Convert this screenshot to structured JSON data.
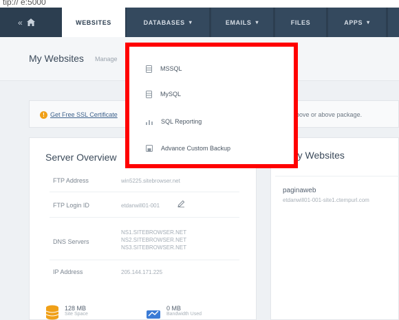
{
  "window": {
    "top_strip_text": "tip:// e:5000"
  },
  "navbar": {
    "home_label": "«",
    "tabs": [
      {
        "label": "WEBSITES",
        "active": true,
        "has_caret": false
      },
      {
        "label": "DATABASES",
        "active": false,
        "has_caret": true
      },
      {
        "label": "EMAILS",
        "active": false,
        "has_caret": true
      },
      {
        "label": "FILES",
        "active": false,
        "has_caret": false
      },
      {
        "label": "APPS",
        "active": false,
        "has_caret": true
      }
    ],
    "caret": "▾"
  },
  "header": {
    "title": "My Websites",
    "subtitle": "Manage"
  },
  "notice": {
    "icon": "!",
    "link_text": "Get Free SSL Certificate",
    "text": "above or above package."
  },
  "server_overview": {
    "title": "Server Overview",
    "rows": [
      {
        "label": "FTP Address",
        "values": [
          "win5225.sitebrowser.net"
        ]
      },
      {
        "label": "FTP Login ID",
        "values": [
          "etdanwill01-001"
        ]
      },
      {
        "label": "DNS Servers",
        "values": [
          "NS1.SITEBROWSER.NET",
          "NS2.SITEBROWSER.NET",
          "NS3.SITEBROWSER.NET"
        ]
      },
      {
        "label": "IP Address",
        "values": [
          "205.144.171.225"
        ]
      }
    ],
    "stats": [
      {
        "value": "128 MB",
        "label": "Site Space"
      },
      {
        "value": "0 MB",
        "label": "Bandwidth Used"
      }
    ]
  },
  "my_websites": {
    "title": "My Websites",
    "site_name": "paginaweb",
    "site_sub": "etdanwill01-001-site1.ctempurl.com"
  },
  "databases_menu": {
    "items": [
      {
        "label": "MSSQL",
        "icon": "database-icon"
      },
      {
        "label": "MySQL",
        "icon": "database-icon"
      },
      {
        "label": "SQL Reporting",
        "icon": "bar-chart-icon"
      },
      {
        "label": "Advance Custom Backup",
        "icon": "backup-icon"
      }
    ],
    "highlight_color": "#ff0000"
  },
  "colors": {
    "navbar": "#2c3e50",
    "accent": "#f0a018"
  }
}
